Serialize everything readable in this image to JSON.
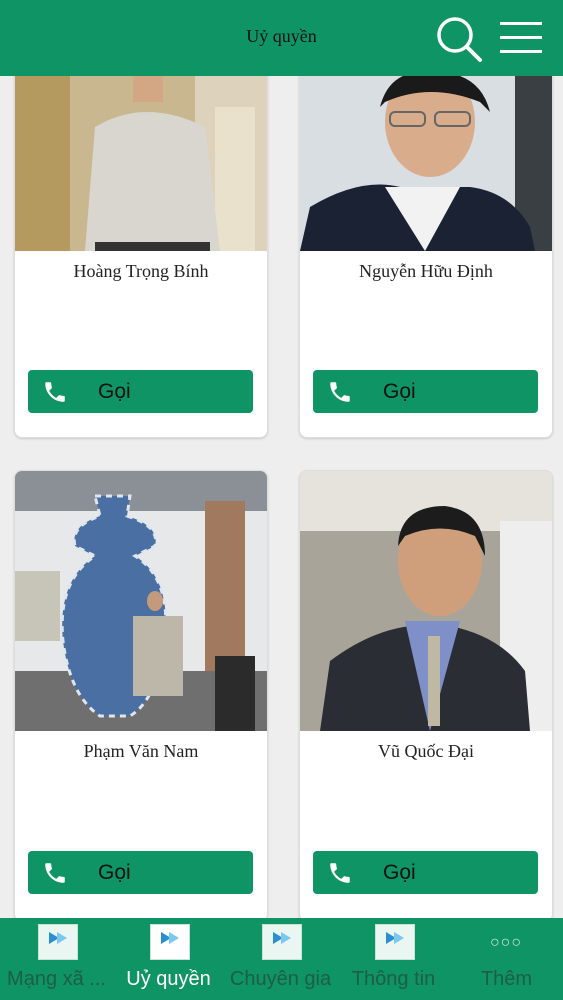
{
  "header": {
    "title": "Uỷ quyền",
    "search_icon": "search-icon",
    "menu_icon": "hamburger-menu-icon"
  },
  "people": [
    {
      "name": "Hoàng Trọng Bính",
      "call_label": "Gọi"
    },
    {
      "name": "Nguyễn Hữu Định",
      "call_label": "Gọi"
    },
    {
      "name": "Phạm Văn Nam",
      "call_label": "Gọi"
    },
    {
      "name": "Vũ Quốc Đại",
      "call_label": "Gọi"
    }
  ],
  "tabs": [
    {
      "label": "Mạng xã ...",
      "icon": "app-logo-icon"
    },
    {
      "label": "Uỷ quyền",
      "icon": "app-logo-icon",
      "active": true
    },
    {
      "label": "Chuyên gia",
      "icon": "app-logo-icon"
    },
    {
      "label": "Thông tin",
      "icon": "app-logo-icon"
    },
    {
      "label": "Thêm",
      "icon": "more-dots-icon"
    }
  ],
  "colors": {
    "primary": "#0f9466",
    "background": "#eeeeee",
    "card": "#ffffff"
  }
}
